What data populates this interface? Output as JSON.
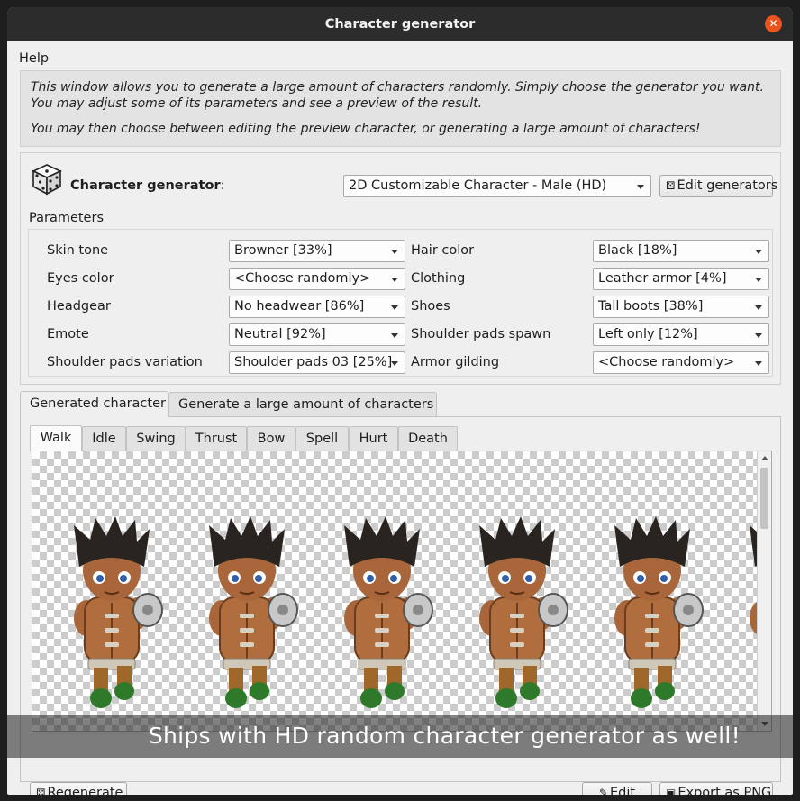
{
  "window": {
    "title": "Character generator"
  },
  "menu": {
    "help": "Help"
  },
  "info": {
    "line1": "This window allows you to generate a large amount of characters randomly. Simply choose the generator you want. You may adjust some of its parameters and see a preview of the result.",
    "line2": "You may then choose between editing the preview character, or generating a large amount of characters!"
  },
  "generator": {
    "label": "Character generator",
    "label_suffix": ":",
    "selected": "2D Customizable Character - Male (HD)",
    "edit_button": "Edit generators"
  },
  "parameters": {
    "title": "Parameters",
    "left": [
      {
        "label": "Skin tone",
        "value": "Browner [33%]"
      },
      {
        "label": "Eyes color",
        "value": "<Choose randomly>"
      },
      {
        "label": "Headgear",
        "value": "No headwear [86%]"
      },
      {
        "label": "Emote",
        "value": "Neutral [92%]"
      },
      {
        "label": "Shoulder pads variation",
        "value": "Shoulder pads 03 [25%]"
      }
    ],
    "right": [
      {
        "label": "Hair color",
        "value": "Black [18%]"
      },
      {
        "label": "Clothing",
        "value": "Leather armor [4%]"
      },
      {
        "label": "Shoes",
        "value": "Tall boots [38%]"
      },
      {
        "label": "Shoulder pads spawn",
        "value": "Left only [12%]"
      },
      {
        "label": "Armor gilding",
        "value": "<Choose randomly>"
      }
    ]
  },
  "main_tabs": [
    "Generated character",
    "Generate a large amount of characters"
  ],
  "anim_tabs": [
    "Walk",
    "Idle",
    "Swing",
    "Thrust",
    "Bow",
    "Spell",
    "Hurt",
    "Death"
  ],
  "buttons": {
    "regenerate": "Regenerate",
    "edit": "Edit",
    "export": "Export as PNG"
  },
  "caption": "Ships with HD random character generator as well!",
  "colors": {
    "skin": "#a8663a",
    "hair": "#2a2420",
    "pants": "#a0672a",
    "boots": "#2f7a2a",
    "close": "#e9541f"
  }
}
